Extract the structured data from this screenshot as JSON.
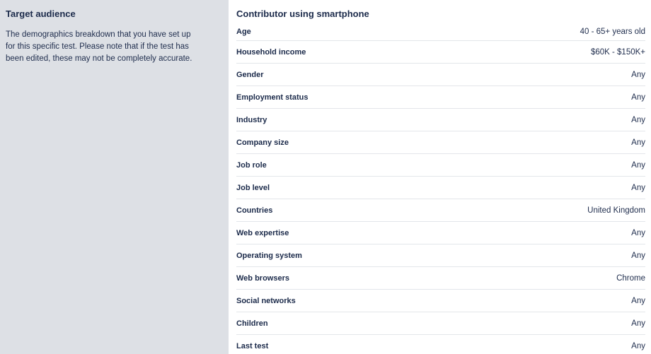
{
  "sidebar": {
    "title": "Target audience",
    "description": "The demographics breakdown that you have set up for this specific test. Please note that if the test has been edited, these may not be completely accurate."
  },
  "main": {
    "title": "Contributor using smartphone",
    "rows": [
      {
        "label": "Age",
        "value": "40 - 65+ years old"
      },
      {
        "label": "Household income",
        "value": "$60K - $150K+"
      },
      {
        "label": "Gender",
        "value": "Any"
      },
      {
        "label": "Employment status",
        "value": "Any"
      },
      {
        "label": "Industry",
        "value": "Any"
      },
      {
        "label": "Company size",
        "value": "Any"
      },
      {
        "label": "Job role",
        "value": "Any"
      },
      {
        "label": "Job level",
        "value": "Any"
      },
      {
        "label": "Countries",
        "value": "United Kingdom"
      },
      {
        "label": "Web expertise",
        "value": "Any"
      },
      {
        "label": "Operating system",
        "value": "Any"
      },
      {
        "label": "Web browsers",
        "value": "Chrome"
      },
      {
        "label": "Social networks",
        "value": "Any"
      },
      {
        "label": "Children",
        "value": "Any"
      },
      {
        "label": "Last test",
        "value": "Any"
      }
    ]
  }
}
